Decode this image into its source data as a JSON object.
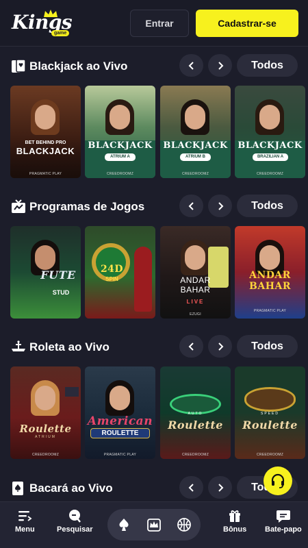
{
  "header": {
    "logo_text": "Kings",
    "logo_badge": "game",
    "login_label": "Entrar",
    "register_label": "Cadastrar-se"
  },
  "sections": [
    {
      "title": "Blackjack ao Vivo",
      "icon": "playing-card-icon",
      "all_label": "Todos",
      "cards": [
        {
          "title": "BLACKJACK",
          "pre": "BET BEHIND PRO",
          "tag": "",
          "provider": "PRAGMATIC PLAY"
        },
        {
          "title": "BLACKJACK",
          "pre": "",
          "tag": "ATRIUM A",
          "provider": "CREEDROOMZ"
        },
        {
          "title": "BLACKJACK",
          "pre": "",
          "tag": "ATRIUM B",
          "provider": "CREEDROOMZ"
        },
        {
          "title": "BLACKJACK",
          "pre": "",
          "tag": "BRAZILIAN A",
          "provider": "CREEDROOMZ"
        }
      ]
    },
    {
      "title": "Programas de Jogos",
      "icon": "tv-icon",
      "all_label": "Todos",
      "cards": [
        {
          "title": "FUTE",
          "sub": "STUD",
          "provider": ""
        },
        {
          "title": "24D",
          "sub": "SPIN",
          "provider": ""
        },
        {
          "title": "ANDAR BAHAR",
          "sub": "LIVE",
          "provider": "EZUGI"
        },
        {
          "title": "ANDAR BAHAR",
          "sub": "",
          "provider": "PRAGMATIC PLAY"
        }
      ]
    },
    {
      "title": "Roleta ao Vivo",
      "icon": "roulette-icon",
      "all_label": "Todos",
      "cards": [
        {
          "title": "Roulette",
          "sub": "ATRIUM",
          "provider": "CREEDROOMZ"
        },
        {
          "title": "American",
          "sub": "ROULETTE",
          "provider": "PRAGMATIC PLAY"
        },
        {
          "title": "Roulette",
          "sub": "AUTO",
          "provider": "CREEDROOMZ"
        },
        {
          "title": "Roulette",
          "sub": "SPEED",
          "provider": "CREEDROOMZ"
        }
      ]
    },
    {
      "title": "Bacará ao Vivo",
      "icon": "spade-card-icon",
      "all_label": "Todos"
    }
  ],
  "bottom_nav": {
    "menu": "Menu",
    "search": "Pesquisar",
    "bonus": "Bônus",
    "chat": "Bate-papo"
  },
  "colors": {
    "accent": "#f7f11e",
    "background": "#1c1d2a",
    "pill": "#2b2c3b"
  }
}
